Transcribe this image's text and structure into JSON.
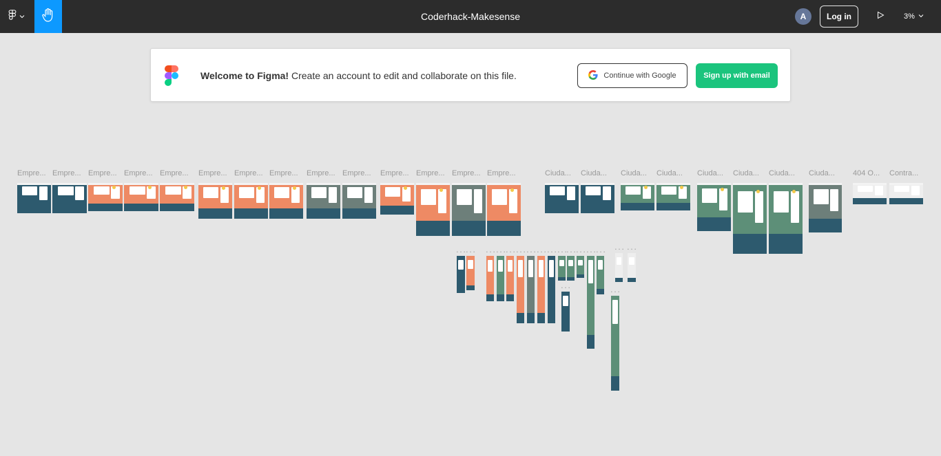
{
  "topbar": {
    "file_title": "Coderhack-Makesense",
    "avatar_initial": "A",
    "login_label": "Log in",
    "zoom_level": "3%"
  },
  "banner": {
    "welcome_bold": "Welcome to Figma!",
    "welcome_text": " Create an account to edit and collaborate on this file.",
    "google_label": "Continue with Google",
    "email_label": "Sign up with email"
  },
  "frames": {
    "labels": [
      "Empre...",
      "Empre...",
      "Empre...",
      "Empre...",
      "Empre...",
      "Empre...",
      "Empre...",
      "Empre...",
      "Empre...",
      "Empre...",
      "Empre...",
      "Empre...",
      "Empre...",
      "Empre...",
      "Ciuda...",
      "Ciuda...",
      "Ciuda...",
      "Ciuda...",
      "Ciuda...",
      "Ciuda...",
      "Ciuda...",
      "Ciuda...",
      "404 O...",
      "Contra..."
    ]
  },
  "colors": {
    "topbar": "#2c2c2c",
    "accent_blue": "#0d99ff",
    "signup_green": "#1bc47d",
    "canvas": "#e5e5e5",
    "frame_teal": "#2d5a6e",
    "frame_orange": "#ee8a64",
    "frame_green": "#5d8f78"
  }
}
